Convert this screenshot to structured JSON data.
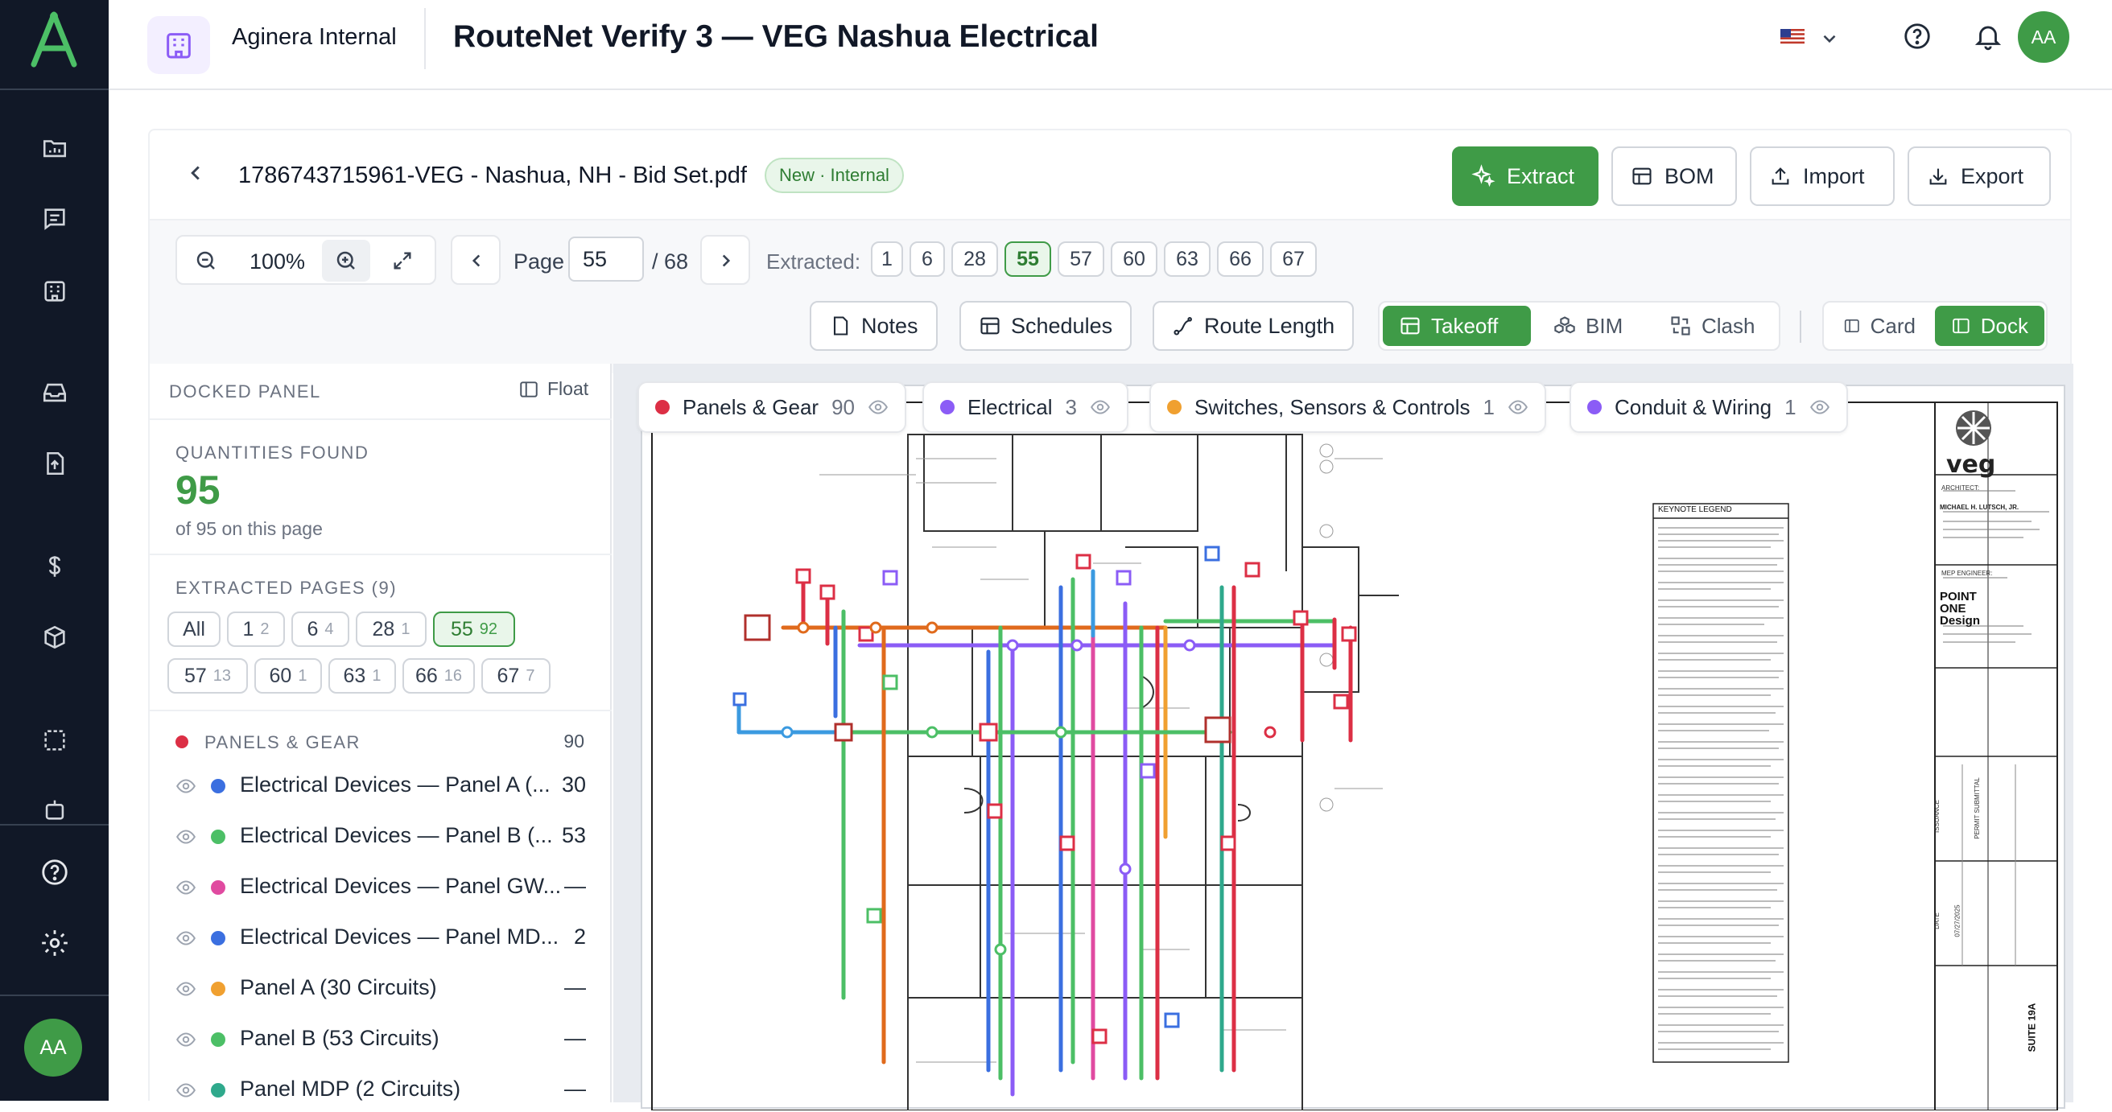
{
  "header": {
    "workspace": "Aginera Internal",
    "title": "RouteNet Verify 3 — VEG Nashua Electrical",
    "avatar": "AA"
  },
  "rail": {
    "avatar": "AA"
  },
  "document": {
    "filename": "1786743715961-VEG - Nashua, NH - Bid Set.pdf",
    "status_badge": "New · Internal",
    "actions": {
      "extract": "Extract",
      "bom": "BOM",
      "import": "Import",
      "export": "Export"
    }
  },
  "viewer": {
    "zoom": "100%",
    "page_label": "Page",
    "page_value": "55",
    "page_total": "/ 68",
    "extracted_label": "Extracted:",
    "extracted_pages": [
      "1",
      "6",
      "28",
      "55",
      "57",
      "60",
      "63",
      "66",
      "67"
    ],
    "active_page": "55"
  },
  "tools": {
    "notes": "Notes",
    "schedules": "Schedules",
    "route_length": "Route Length",
    "takeoff": "Takeoff",
    "bim": "BIM",
    "clash": "Clash",
    "card": "Card",
    "dock": "Dock"
  },
  "panel": {
    "title": "DOCKED PANEL",
    "float": "Float",
    "quantities_label": "QUANTITIES FOUND",
    "quantities_value": "95",
    "quantities_sub": "of 95 on this page",
    "pages_label": "EXTRACTED PAGES (9)",
    "page_chips": [
      {
        "label": "All",
        "count": ""
      },
      {
        "label": "1",
        "count": "2"
      },
      {
        "label": "6",
        "count": "4"
      },
      {
        "label": "28",
        "count": "1"
      },
      {
        "label": "55",
        "count": "92"
      },
      {
        "label": "57",
        "count": "13"
      },
      {
        "label": "60",
        "count": "1"
      },
      {
        "label": "63",
        "count": "1"
      },
      {
        "label": "66",
        "count": "16"
      },
      {
        "label": "67",
        "count": "7"
      }
    ],
    "category": {
      "name": "PANELS & GEAR",
      "count": "90",
      "color": "#dc2f45"
    },
    "items": [
      {
        "label": "Electrical Devices — Panel A (...",
        "count": "30",
        "color": "#3b6fe0"
      },
      {
        "label": "Electrical Devices — Panel B (...",
        "count": "53",
        "color": "#4cbf66"
      },
      {
        "label": "Electrical Devices — Panel GW...",
        "count": "—",
        "color": "#e04aa0"
      },
      {
        "label": "Electrical Devices — Panel MD...",
        "count": "2",
        "color": "#3b6fe0"
      },
      {
        "label": "Panel A (30 Circuits)",
        "count": "—",
        "color": "#f0a030"
      },
      {
        "label": "Panel B (53 Circuits)",
        "count": "—",
        "color": "#4cbf66"
      },
      {
        "label": "Panel MDP (2 Circuits)",
        "count": "—",
        "color": "#2fa98c"
      }
    ]
  },
  "legend": [
    {
      "name": "Panels & Gear",
      "count": "90",
      "color": "#dc2f45"
    },
    {
      "name": "Electrical",
      "count": "3",
      "color": "#8b5cf6"
    },
    {
      "name": "Switches, Sensors & Controls",
      "count": "1",
      "color": "#f0a030"
    },
    {
      "name": "Conduit & Wiring",
      "count": "1",
      "color": "#8b5cf6"
    }
  ],
  "drawing": {
    "keynote_title": "KEYNOTE LEGEND",
    "titleblock": {
      "logo": "veg",
      "architect_label": "ARCHITECT:",
      "architect": "MICHAEL H. LUTSCH, JR.",
      "mep_label": "MEP ENGINEER:",
      "mep_firm": "POINT ONE Design",
      "suite": "SUITE 19A",
      "issuance": "ISSUANCE",
      "permit": "PERMIT SUBMITTAL",
      "date_label": "DATE",
      "date": "07/27/2025"
    }
  }
}
